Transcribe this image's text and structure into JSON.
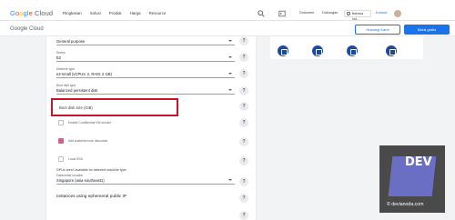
{
  "header": {
    "logo": "Google Cloud",
    "nav": [
      "Ringkasan",
      "Solusi",
      "Produk",
      "Harga",
      "Resource"
    ],
    "docs": "Dokumen",
    "support": "Dukungan",
    "language": "Bahasa Ind...",
    "console": "Konsol"
  },
  "subheader": {
    "title": "Google Cloud",
    "contact_sales": "Hubungi Kami",
    "free_trial": "Mulai gratis"
  },
  "form": {
    "fields": [
      {
        "label": "",
        "value": "General purpose"
      },
      {
        "label": "Series",
        "value": "E2"
      },
      {
        "label": "Machine type",
        "value": "e2-small  (vCPUs: 2, RAM: 2 GB)"
      },
      {
        "label": "Boot disk type",
        "value": "Balanced persistent disk"
      }
    ],
    "boot_disk_placeholder": "Boot disk size (GiB)",
    "checkbox_1": "Enable Confidential VM service",
    "checkbox_2": "Add sustained use discounts",
    "checkbox_3": "Local SSD",
    "gpu_note": "GPUs aren't available for selected machine type.",
    "datacenter_label": "Datacenter location",
    "datacenter_value": "Singapore (asia-southeast1)",
    "ephemeral_ip": "Instances using ephemeral public IP",
    "help_symbol": "?"
  },
  "watermark": {
    "brand": "DEV",
    "site": "© devianoda.com"
  },
  "colors": {
    "accent": "#1a73e8",
    "highlight": "#c4152b",
    "watermark_bg": "#4a4a4a"
  }
}
